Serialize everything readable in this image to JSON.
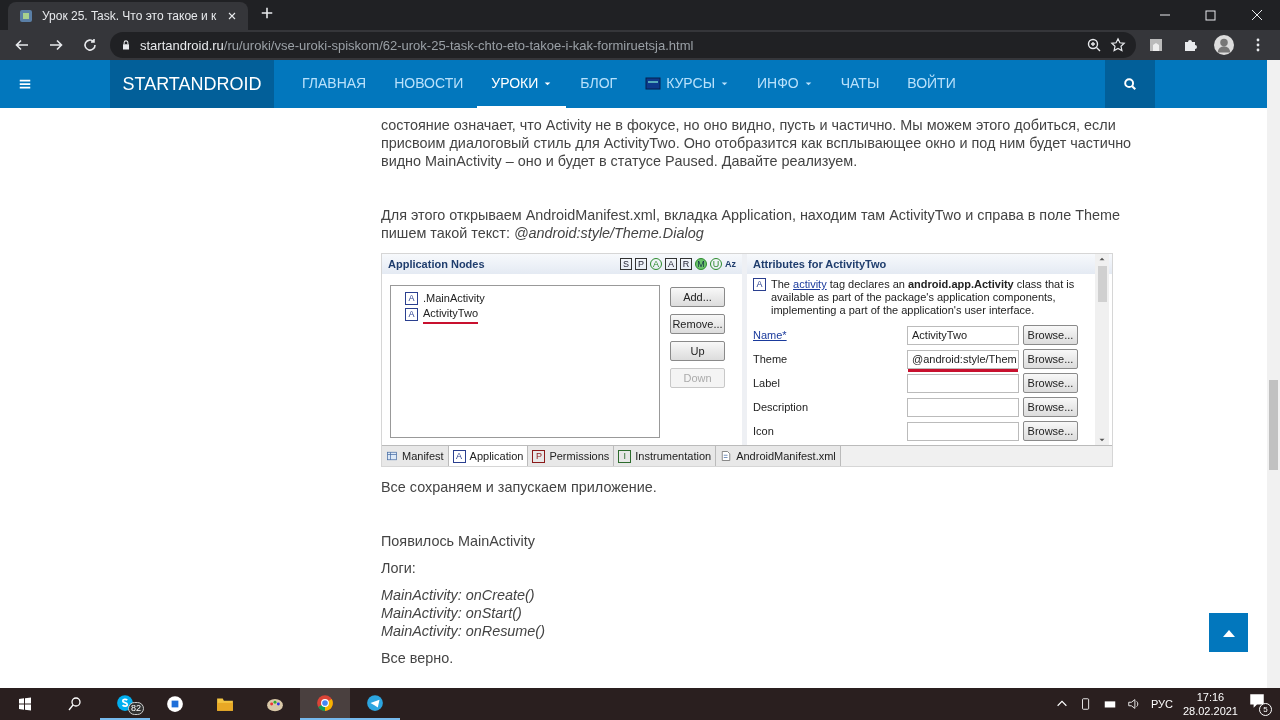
{
  "browser": {
    "tab_title": "Урок 25. Task. Что это такое и к",
    "url_host": "startandroid.ru",
    "url_path": "/ru/uroki/vse-uroki-spiskom/62-urok-25-task-chto-eto-takoe-i-kak-formiruetsja.html"
  },
  "nav": {
    "brand": "STARTANDROID",
    "items": [
      {
        "label": "ГЛАВНАЯ",
        "dropdown": false,
        "selected": false,
        "icon": false
      },
      {
        "label": "НОВОСТИ",
        "dropdown": false,
        "selected": false,
        "icon": false
      },
      {
        "label": "УРОКИ",
        "dropdown": true,
        "selected": true,
        "icon": false
      },
      {
        "label": "БЛОГ",
        "dropdown": false,
        "selected": false,
        "icon": false
      },
      {
        "label": "КУРСЫ",
        "dropdown": true,
        "selected": false,
        "icon": true
      },
      {
        "label": "ИНФО",
        "dropdown": true,
        "selected": false,
        "icon": false
      },
      {
        "label": "ЧАТЫ",
        "dropdown": false,
        "selected": false,
        "icon": false
      },
      {
        "label": "ВОЙТИ",
        "dropdown": false,
        "selected": false,
        "icon": false
      }
    ]
  },
  "article_top": [
    {
      "kind": "para",
      "text": "состояние означает, что Activity не в фокусе, но оно видно, пусть и частично. Мы можем этого добиться, если присвоим диалоговый стиль для ActivityTwo. Оно отобразится как всплывающее окно и под ним будет частично видно MainActivity – оно и будет в статусе Paused. Давайте реализуем."
    },
    {
      "kind": "gap"
    },
    {
      "kind": "para",
      "text": "Для этого открываем AndroidManifest.xml, вкладка Application, находим там ActivityTwo и справа в поле Theme пишем такой текст: *@android:style/Theme.Dialog*"
    }
  ],
  "editor": {
    "left_title": "Application Nodes",
    "filters": [
      {
        "label": "S",
        "kind": "box"
      },
      {
        "label": "P",
        "kind": "box"
      },
      {
        "label": "A",
        "kind": "ring"
      },
      {
        "label": "A",
        "kind": "box"
      },
      {
        "label": "R",
        "kind": "box"
      },
      {
        "label": "M",
        "kind": "disc"
      },
      {
        "label": "U",
        "kind": "ring"
      },
      {
        "label": "Az",
        "kind": "plain"
      }
    ],
    "nodes": [
      {
        "icon": "A",
        "label": ".MainActivity",
        "underlined": false
      },
      {
        "icon": "A",
        "label": "ActivityTwo",
        "underlined": true
      }
    ],
    "buttons": [
      {
        "label": "Add...",
        "disabled": false
      },
      {
        "label": "Remove...",
        "disabled": false
      },
      {
        "label": "Up",
        "disabled": false
      },
      {
        "label": "Down",
        "disabled": true
      }
    ],
    "right_title": "Attributes for ActivityTwo",
    "desc_icon": "A",
    "desc_start": "The",
    "desc_link": "activity",
    "desc_rest": "tag declares an **android.app.Activity** class that is available as part of the package's application components, implementing a part of the application's user interface.",
    "fields": [
      {
        "label": "Name*",
        "link": true,
        "value": "ActivityTwo",
        "underlined": false,
        "browse": "Browse..."
      },
      {
        "label": "Theme",
        "link": false,
        "value": "@android:style/Them",
        "underlined": true,
        "browse": "Browse..."
      },
      {
        "label": "Label",
        "link": false,
        "underlined": false,
        "browse": "Browse..."
      },
      {
        "label": "Description",
        "link": false,
        "underlined": false,
        "browse": "Browse..."
      },
      {
        "label": "Icon",
        "link": false,
        "underlined": false,
        "browse": "Browse..."
      }
    ],
    "tabs": [
      {
        "kind": "table",
        "label": "Manifest",
        "selected": false
      },
      {
        "kind": "letter",
        "icon": "A",
        "label": "Application",
        "selected": true
      },
      {
        "kind": "letter",
        "icon": "P",
        "label": "Permissions",
        "selected": false
      },
      {
        "kind": "letter",
        "icon": "I",
        "label": "Instrumentation",
        "selected": false
      },
      {
        "kind": "file",
        "label": "AndroidManifest.xml",
        "selected": false
      }
    ]
  },
  "article_bottom": [
    {
      "kind": "para",
      "text": "Все сохраняем и запускаем приложение."
    },
    {
      "kind": "gap"
    },
    {
      "kind": "para",
      "text": "Появилось MainActivity"
    },
    {
      "kind": "para",
      "text": "Логи:"
    },
    {
      "kind": "log",
      "text": "MainActivity: onCreate()"
    },
    {
      "kind": "log",
      "text": "MainActivity: onStart()"
    },
    {
      "kind": "log",
      "text": "MainActivity: onResume()"
    },
    {
      "kind": "para",
      "text": "Все верно."
    }
  ],
  "taskbar": {
    "apps": [
      {
        "kind": "skype",
        "badge": "82",
        "open": true,
        "selected": false
      },
      {
        "kind": "word",
        "open": false,
        "selected": false
      },
      {
        "kind": "folder",
        "open": false,
        "selected": false
      },
      {
        "kind": "paint",
        "open": false,
        "selected": false
      },
      {
        "kind": "chrome",
        "open": true,
        "selected": true
      },
      {
        "kind": "telegram",
        "open": true,
        "selected": false
      }
    ],
    "language": "РУС",
    "time": "17:16",
    "date": "28.02.2021",
    "notifications": "5"
  }
}
